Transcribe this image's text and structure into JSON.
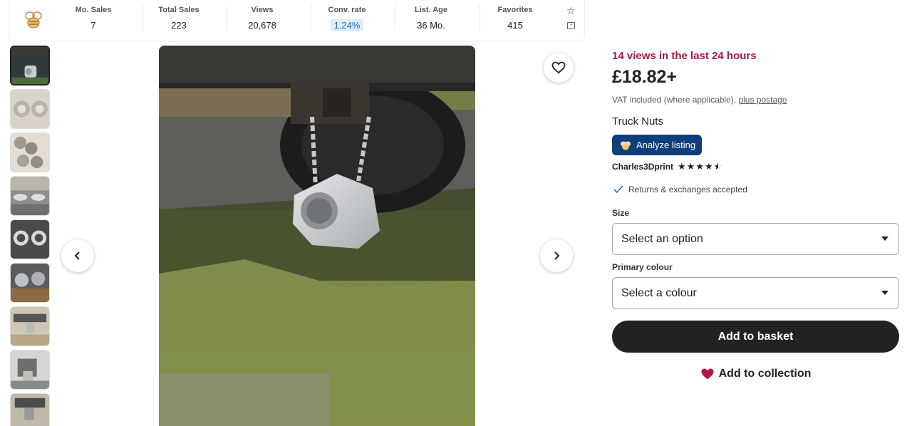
{
  "stats": {
    "items": [
      {
        "label": "Mo. Sales",
        "value": "7"
      },
      {
        "label": "Total Sales",
        "value": "223"
      },
      {
        "label": "Views",
        "value": "20,678"
      },
      {
        "label": "Conv. rate",
        "value": "1.24%"
      },
      {
        "label": "List. Age",
        "value": "36 Mo."
      },
      {
        "label": "Favorites",
        "value": "415"
      }
    ],
    "icons": [
      "bee-logo-icon",
      "star-icon",
      "embed-icon"
    ]
  },
  "gallery": {
    "thumbnail_count": 9,
    "active_index": 0,
    "icons": [
      "chevron-left-icon",
      "chevron-right-icon",
      "heart-outline-icon"
    ]
  },
  "listing": {
    "views_24h": "14 views in the last 24 hours",
    "price": "£18.82+",
    "vat_text": "VAT included (where applicable),",
    "postage_link": "plus postage",
    "title": "Truck Nuts",
    "analyze_label": "Analyze listing",
    "shop_name": "Charles3Dprint",
    "rating_stars": 4.5,
    "returns_text": "Returns & exchanges accepted",
    "size_label": "Size",
    "size_placeholder": "Select an option",
    "colour_label": "Primary colour",
    "colour_placeholder": "Select a colour",
    "basket_label": "Add to basket",
    "collection_label": "Add to collection"
  },
  "colors": {
    "views_accent": "#a61a4a",
    "analyze_bg": "#0e3f7a",
    "button_dark": "#222222",
    "heart_red": "#b3154a",
    "conv_highlight_bg": "#dcecf9"
  }
}
